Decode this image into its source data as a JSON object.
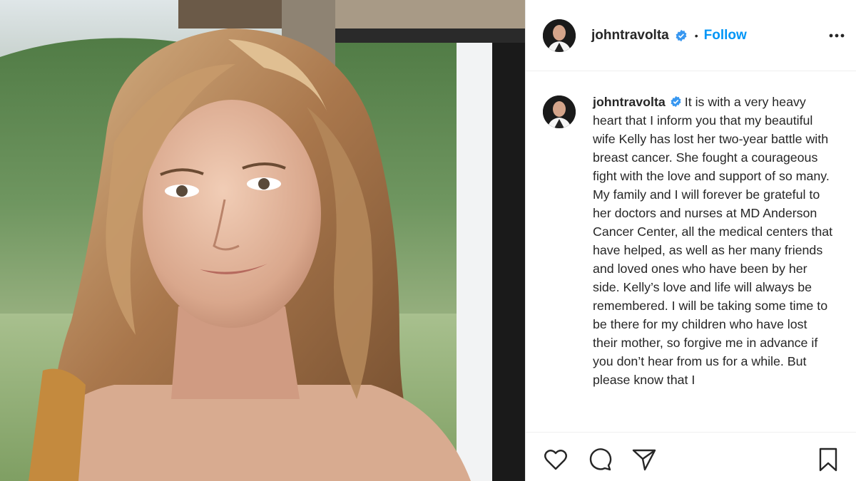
{
  "post": {
    "username": "johntravolta",
    "follow_label": "Follow",
    "separator": "•",
    "caption": "It is with a very heavy heart that I inform you that my beautiful wife Kelly has lost her two-year battle with breast cancer. She fought a courageous fight with the love and support of so many.  My family and I will forever be grateful to her doctors and nurses at MD Anderson Cancer Center, all the medical centers that have helped, as well as her many friends and loved ones who have been by her side. Kelly’s love and life will always be remembered. I will be taking some time to be there for my children who have lost their mother, so forgive me in advance if you don’t hear from us for a while.  But please know that I"
  },
  "icons": {
    "verified": "verified-badge-icon",
    "more": "more-options-icon",
    "like": "heart-icon",
    "comment": "comment-icon",
    "share": "share-icon",
    "save": "bookmark-icon"
  },
  "colors": {
    "follow_blue": "#0095f6",
    "verified_blue": "#3897f0",
    "text": "#262626",
    "divider": "#efefef"
  }
}
